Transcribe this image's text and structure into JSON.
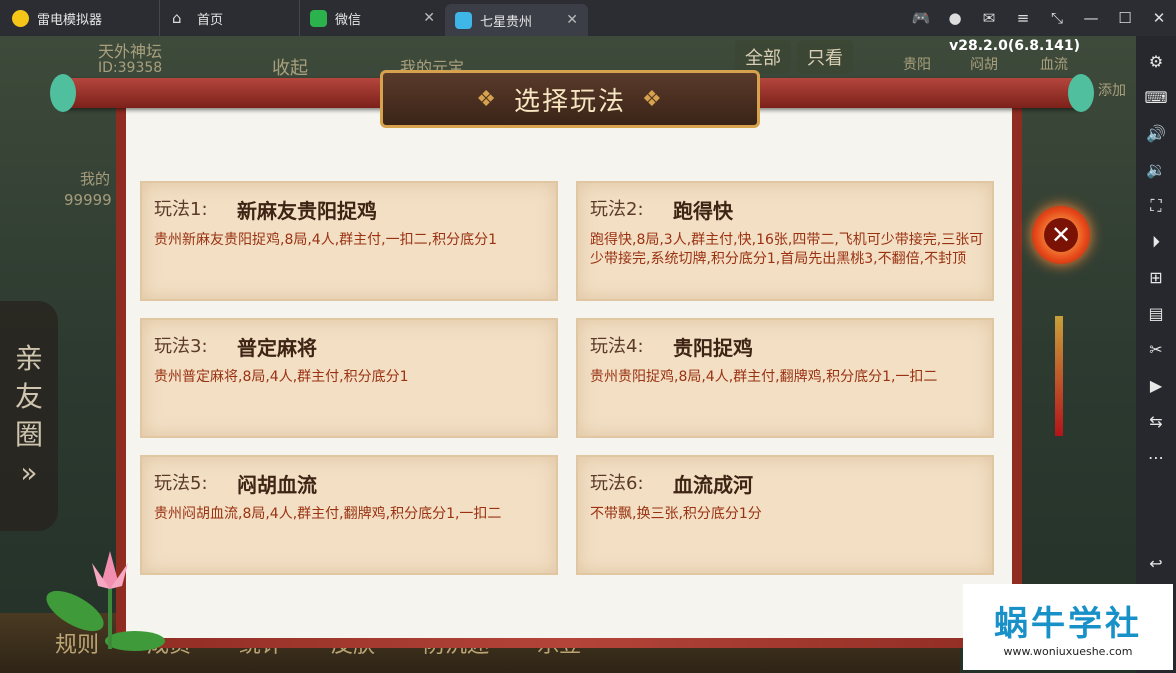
{
  "titlebar": {
    "app_name": "雷电模拟器",
    "tabs": [
      {
        "label": "首页"
      },
      {
        "label": "微信"
      },
      {
        "label": "七星贵州"
      }
    ]
  },
  "game_bg": {
    "player_name": "天外神坛",
    "player_id": "ID:39358",
    "collapse_label": "收起",
    "yuanbao_label": "我的元宝",
    "filter_all": "全部",
    "filter_only": "只看",
    "filter_tabs": [
      "贵阳",
      "闷胡",
      "血流"
    ],
    "add_label": "添加",
    "my_label": "我的",
    "coins": "99999",
    "version": "v28.2.0(6.8.141)",
    "side_tab_chars": [
      "亲",
      "友",
      "圈"
    ],
    "side_tab_more": "»",
    "bottom_menu": [
      "规则",
      "成员",
      "统计",
      "皮肤",
      "防沉迷",
      "乐豆"
    ]
  },
  "dialog": {
    "title": "选择玩法",
    "cards": [
      {
        "hdr": "玩法1:",
        "name": "新麻友贵阳捉鸡",
        "desc": "贵州新麻友贵阳捉鸡,8局,4人,群主付,一扣二,积分底分1"
      },
      {
        "hdr": "玩法2:",
        "name": "跑得快",
        "desc": "跑得快,8局,3人,群主付,快,16张,四带二,飞机可少带接完,三张可少带接完,系统切牌,积分底分1,首局先出黑桃3,不翻倍,不封顶"
      },
      {
        "hdr": "玩法3:",
        "name": "普定麻将",
        "desc": "贵州普定麻将,8局,4人,群主付,积分底分1"
      },
      {
        "hdr": "玩法4:",
        "name": "贵阳捉鸡",
        "desc": "贵州贵阳捉鸡,8局,4人,群主付,翻牌鸡,积分底分1,一扣二"
      },
      {
        "hdr": "玩法5:",
        "name": "闷胡血流",
        "desc": "贵州闷胡血流,8局,4人,群主付,翻牌鸡,积分底分1,一扣二"
      },
      {
        "hdr": "玩法6:",
        "name": "血流成河",
        "desc": "不带飘,换三张,积分底分1分"
      }
    ]
  },
  "watermark": {
    "title": "蜗牛学社",
    "url": "www.woniuxueshe.com"
  }
}
